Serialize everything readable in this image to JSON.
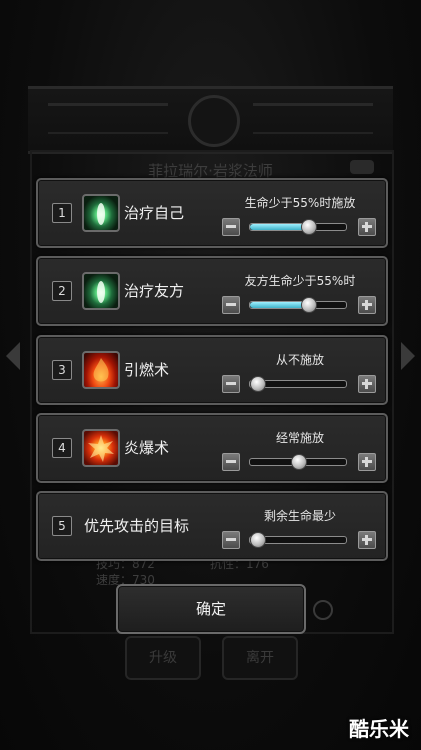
{
  "background": {
    "character_title": "菲拉瑞尔·岩浆法师",
    "stats_left": [
      "技巧：872",
      "速度：730"
    ],
    "stats_right": [
      "抗性：176"
    ],
    "buttons": [
      "升级",
      "离开"
    ]
  },
  "rules": [
    {
      "index": "1",
      "skill": "治疗自己",
      "icon": "heal-icon",
      "condition": "生命少于55%时施放",
      "level": 0.6,
      "filled": true
    },
    {
      "index": "2",
      "skill": "治疗友方",
      "icon": "heal-icon",
      "condition": "友方生命少于55%时",
      "level": 0.6,
      "filled": true
    },
    {
      "index": "3",
      "skill": "引燃术",
      "icon": "fire-icon",
      "condition": "从不施放",
      "level": 0.0,
      "filled": false
    },
    {
      "index": "4",
      "skill": "炎爆术",
      "icon": "explosion-icon",
      "condition": "经常施放",
      "level": 0.5,
      "filled": false
    },
    {
      "index": "5",
      "skill": "优先攻击的目标",
      "icon": "",
      "condition": "剩余生命最少",
      "level": 0.0,
      "filled": false
    }
  ],
  "confirm_label": "确定",
  "watermark": "酷乐米",
  "colors": {
    "slider_fill": "#3fb2c9",
    "panel_border": "#5c5c5c"
  }
}
